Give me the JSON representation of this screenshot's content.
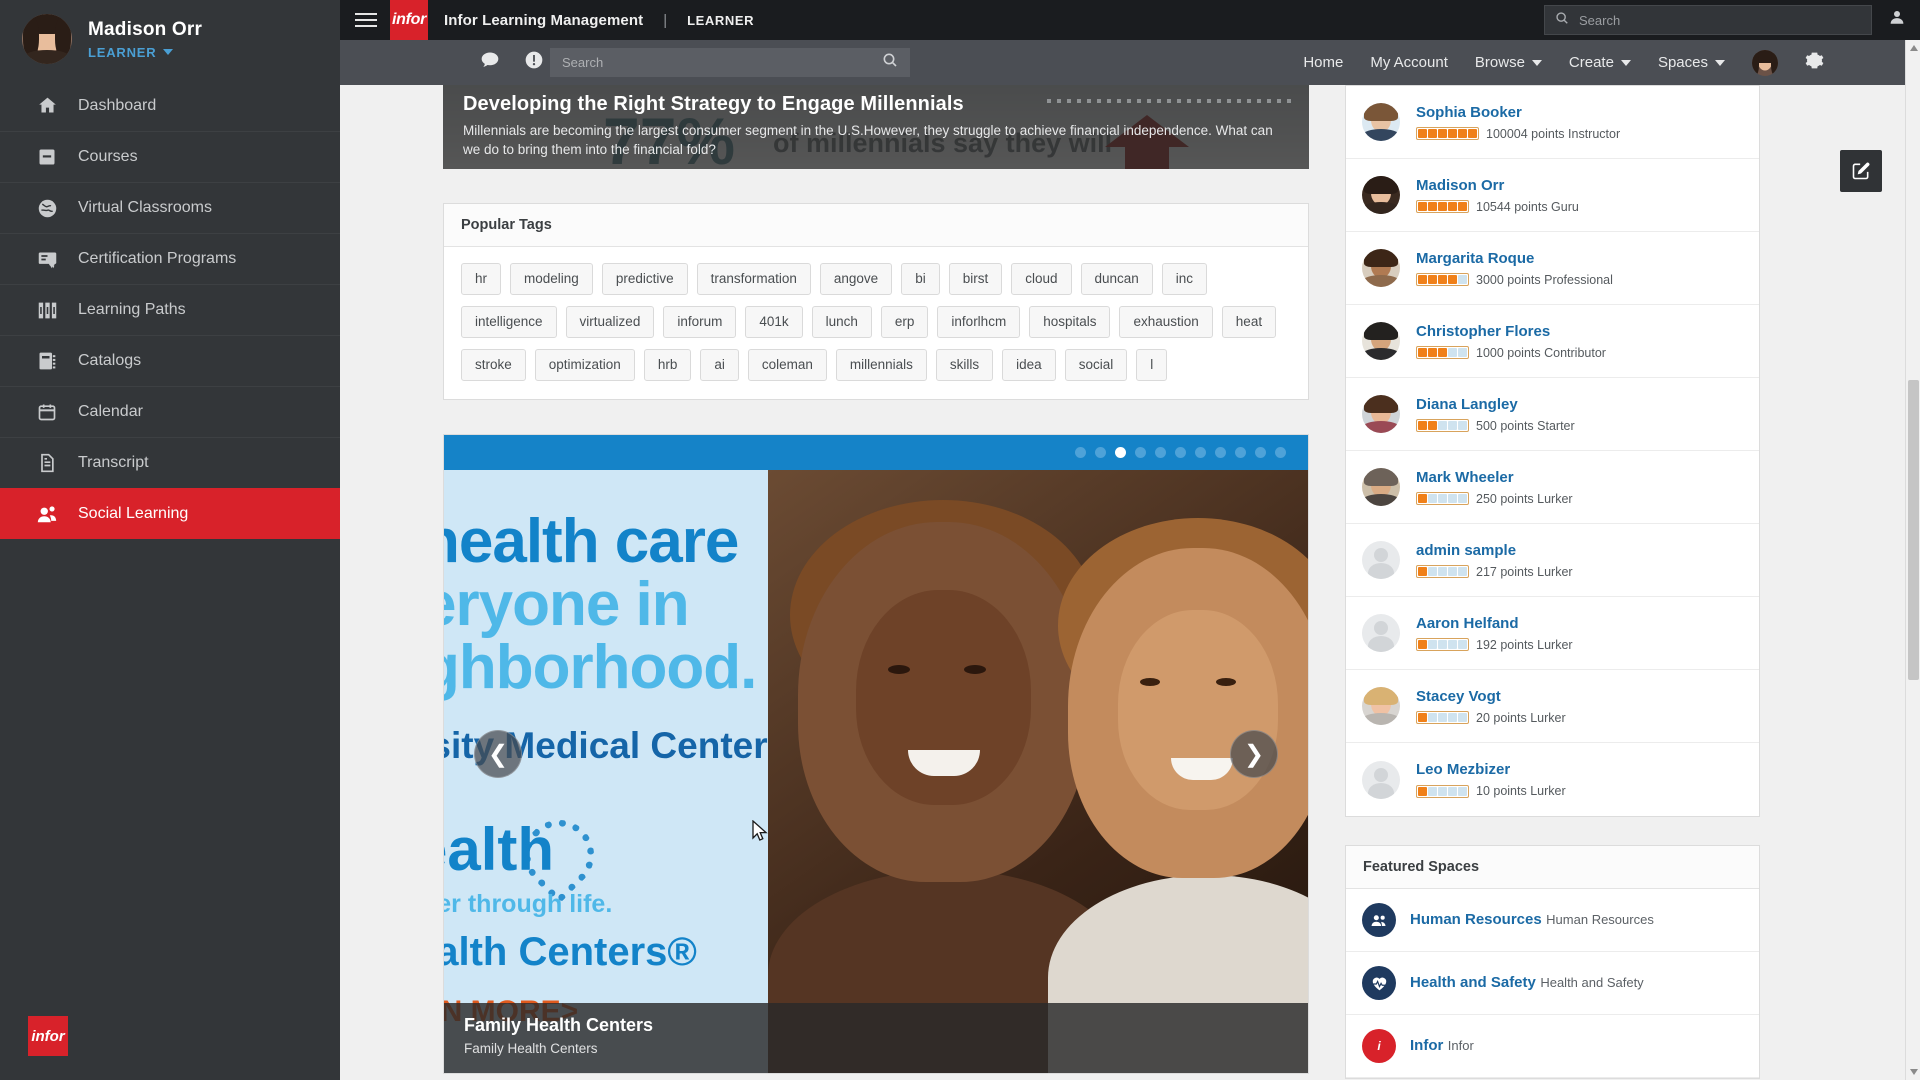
{
  "sidebar": {
    "user": {
      "name": "Madison Orr",
      "role": "LEARNER"
    },
    "items": [
      {
        "label": "Dashboard",
        "icon": "home-icon"
      },
      {
        "label": "Courses",
        "icon": "book-icon"
      },
      {
        "label": "Virtual Classrooms",
        "icon": "globe-icon"
      },
      {
        "label": "Certification Programs",
        "icon": "certificate-icon"
      },
      {
        "label": "Learning Paths",
        "icon": "path-icon"
      },
      {
        "label": "Catalogs",
        "icon": "catalog-icon"
      },
      {
        "label": "Calendar",
        "icon": "calendar-icon"
      },
      {
        "label": "Transcript",
        "icon": "document-icon"
      },
      {
        "label": "Social Learning",
        "icon": "people-icon"
      }
    ],
    "active_index": 8,
    "logo": "infor",
    "accent_color": "#d8222a"
  },
  "topbar": {
    "logo": "infor",
    "app_title": "Infor Learning Management",
    "separator": "|",
    "role": "LEARNER",
    "search_placeholder": "Search"
  },
  "navbar": {
    "search_placeholder": "Search",
    "links": [
      {
        "label": "Home",
        "dropdown": false
      },
      {
        "label": "My Account",
        "dropdown": false
      },
      {
        "label": "Browse",
        "dropdown": true
      },
      {
        "label": "Create",
        "dropdown": true
      },
      {
        "label": "Spaces",
        "dropdown": true
      }
    ]
  },
  "hero": {
    "title": "Developing the Right Strategy to Engage Millennials",
    "description": "Millennials are becoming the largest consumer segment in the U.S.However, they struggle to achieve financial independence. What can we do to bring them into the financial fold?",
    "bg_big_text": "77%",
    "bg_sub_text": "of millennials say they will"
  },
  "popular_tags": {
    "title": "Popular Tags",
    "tags": [
      "hr",
      "modeling",
      "predictive",
      "transformation",
      "angove",
      "bi",
      "birst",
      "cloud",
      "duncan",
      "inc",
      "intelligence",
      "virtualized",
      "inforum",
      "401k",
      "lunch",
      "erp",
      "inforlhcm",
      "hospitals",
      "exhaustion",
      "heat",
      "stroke",
      "optimization",
      "hrb",
      "ai",
      "coleman",
      "millennials",
      "skills",
      "idea",
      "social",
      "l"
    ]
  },
  "carousel": {
    "dot_count": 11,
    "active_dot": 2,
    "prev_label": "❮",
    "next_label": "❯",
    "caption_title": "Family Health Centers",
    "caption_subtitle": "Family Health Centers",
    "slide_text": {
      "line1": "health care",
      "line2": "eryone in",
      "line3": "ghborhood.",
      "sub": "rsity Medical Center",
      "health": "ealth",
      "health_sub": "her through life.",
      "centers": "ealth Centers®",
      "learn": "RN MORE>"
    }
  },
  "people_panel": {
    "people": [
      {
        "name": "Sophia Booker",
        "points": "100004 points Instructor",
        "filled": 6,
        "total": 6,
        "avatar": "photo-female-1"
      },
      {
        "name": "Madison Orr",
        "points": "10544 points Guru",
        "filled": 5,
        "total": 5,
        "avatar": "photo-female-2"
      },
      {
        "name": "Margarita Roque",
        "points": "3000 points Professional",
        "filled": 4,
        "total": 5,
        "avatar": "photo-female-3"
      },
      {
        "name": "Christopher Flores",
        "points": "1000 points Contributor",
        "filled": 3,
        "total": 5,
        "avatar": "photo-male-1"
      },
      {
        "name": "Diana Langley",
        "points": "500 points Starter",
        "filled": 2,
        "total": 5,
        "avatar": "photo-female-4"
      },
      {
        "name": "Mark Wheeler",
        "points": "250 points Lurker",
        "filled": 1,
        "total": 5,
        "avatar": "photo-male-2"
      },
      {
        "name": "admin sample",
        "points": "217 points Lurker",
        "filled": 1,
        "total": 5,
        "avatar": "generic"
      },
      {
        "name": "Aaron Helfand",
        "points": "192 points Lurker",
        "filled": 1,
        "total": 5,
        "avatar": "generic"
      },
      {
        "name": "Stacey Vogt",
        "points": "20 points Lurker",
        "filled": 1,
        "total": 5,
        "avatar": "photo-female-5"
      },
      {
        "name": "Leo Mezbizer",
        "points": "10 points Lurker",
        "filled": 1,
        "total": 5,
        "avatar": "generic"
      }
    ]
  },
  "featured_spaces": {
    "title": "Featured Spaces",
    "spaces": [
      {
        "name": "Human Resources",
        "subtitle": "Human Resources",
        "icon": "people-circle-icon",
        "color": "#1f3a5f"
      },
      {
        "name": "Health and Safety",
        "subtitle": "Health and Safety",
        "icon": "heartbeat-circle-icon",
        "color": "#1f3a5f"
      },
      {
        "name": "Infor",
        "subtitle": "Infor",
        "icon": "infor-circle-icon",
        "color": "#d8222a"
      }
    ]
  },
  "compose": {
    "label": "compose"
  },
  "colors": {
    "brand_red": "#d8222a",
    "link_blue": "#1b6aa5",
    "sidebar_bg": "#333639",
    "carousel_blue": "#1583c8",
    "badge_orange": "#f08019"
  }
}
